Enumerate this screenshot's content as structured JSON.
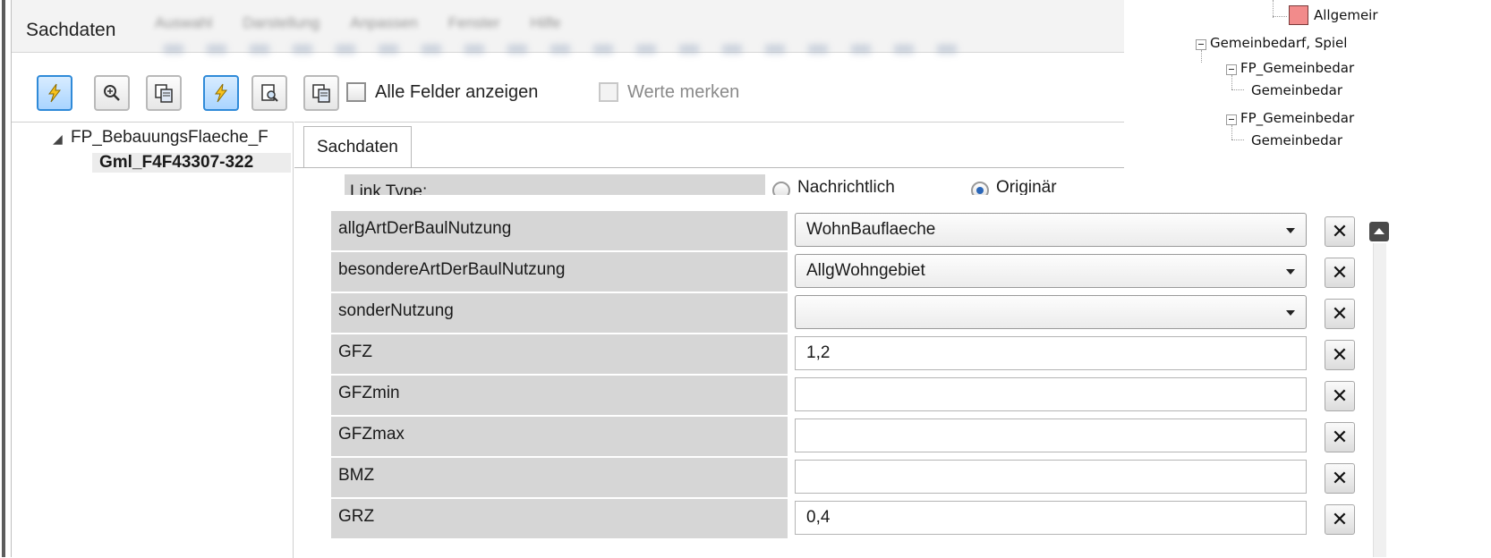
{
  "window": {
    "title": "Sachdaten"
  },
  "toolbar": {
    "show_all_fields": "Alle Felder anzeigen",
    "remember_values": "Werte merken"
  },
  "tree": {
    "root": "FP_BebauungsFlaeche_F",
    "child": "Gml_F4F43307-322"
  },
  "tab": {
    "label": "Sachdaten"
  },
  "link_type": {
    "label": "Link Type:",
    "options": [
      "Nachrichtlich",
      "Originär"
    ],
    "selected": "Originär"
  },
  "layer_tree": {
    "items": [
      {
        "label": "Allgemeir",
        "color": "#f28b8b"
      },
      {
        "label": "Gemeinbedarf, Spiel"
      },
      {
        "label": "FP_Gemeinbedar"
      },
      {
        "label": "Gemeinbedar"
      },
      {
        "label": "FP_Gemeinbedar"
      },
      {
        "label": "Gemeinbedar"
      }
    ]
  },
  "attributes": [
    {
      "name": "allgArtDerBaulNutzung",
      "value": "WohnBauflaeche",
      "type": "combo"
    },
    {
      "name": "besondereArtDerBaulNutzung",
      "value": "AllgWohngebiet",
      "type": "combo"
    },
    {
      "name": "sonderNutzung",
      "value": "",
      "type": "combo"
    },
    {
      "name": "GFZ",
      "value": "1,2",
      "type": "text"
    },
    {
      "name": "GFZmin",
      "value": "",
      "type": "text"
    },
    {
      "name": "GFZmax",
      "value": "",
      "type": "text"
    },
    {
      "name": "BMZ",
      "value": "",
      "type": "text"
    },
    {
      "name": "GRZ",
      "value": "0,4",
      "type": "text"
    }
  ],
  "clear_label": "✕"
}
